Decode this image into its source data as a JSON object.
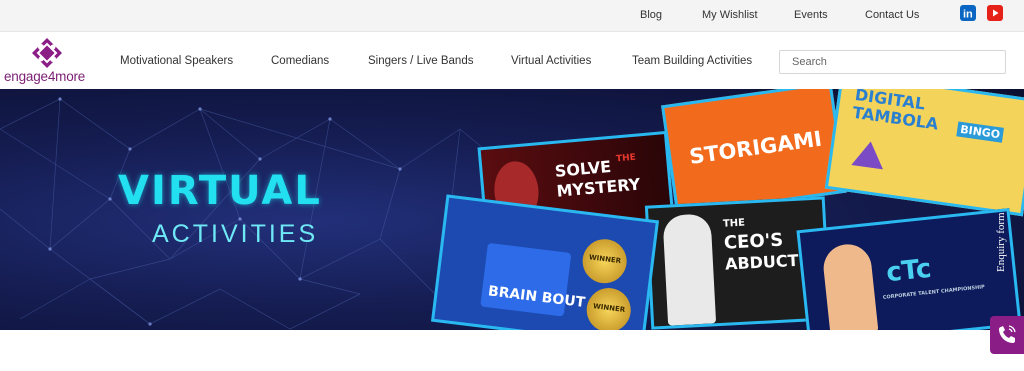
{
  "topbar": {
    "links": [
      "Blog",
      "My Wishlist",
      "Events",
      "Contact Us"
    ],
    "social": [
      "linkedin-icon",
      "youtube-icon"
    ]
  },
  "header": {
    "logo_text": "engage4more",
    "nav": [
      "Motivational Speakers",
      "Comedians",
      "Singers / Live Bands",
      "Virtual Activities",
      "Team Building Activities"
    ],
    "search_placeholder": "Search"
  },
  "hero": {
    "title": "VIRTUAL",
    "subtitle": "ACTIVITIES",
    "cards": {
      "solve": "SOLVE THE MYSTERY",
      "solve_line1": "SOLVE",
      "solve_the": "THE",
      "solve_line2": "MYSTERY",
      "storigami": "STORIGAMI",
      "tambola_line1": "DIGITAL",
      "tambola_line2": "TAMBOLA",
      "bingo": "BINGO",
      "ceo_line1": "THE",
      "ceo_line2": "CEO'S",
      "ceo_line3": "ABDUCTI",
      "brain_bout": "BRAIN BOUT",
      "winner": "WINNER",
      "ctc": "cTc",
      "ctc_caption": "CORPORATE TALENT CHAMPIONSHIP"
    }
  },
  "side": {
    "enquiry_label": "Enquiry form",
    "phone_icon": "phone-icon"
  },
  "colors": {
    "brand_purple": "#8a1d86",
    "hero_cyan": "#22e0f0",
    "linkedin": "#0a66c2",
    "youtube": "#e62117"
  }
}
